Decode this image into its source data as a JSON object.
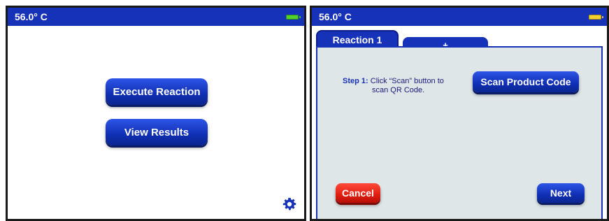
{
  "left_screen": {
    "status": {
      "temperature": "56.0° C",
      "battery_color": "#53d12b"
    },
    "execute_button": "Execute Reaction",
    "results_button": "View Results",
    "settings_icon": "gear-icon"
  },
  "right_screen": {
    "status": {
      "temperature": "56.0° C",
      "battery_color": "#f2d232"
    },
    "tabs": [
      {
        "label": "Reaction 1"
      },
      {
        "label": "+"
      }
    ],
    "step": {
      "label": "Step 1:",
      "text_line1": "Click “Scan” button to",
      "text_line2": "scan QR Code."
    },
    "scan_button": "Scan Product Code",
    "cancel_button": "Cancel",
    "next_button": "Next"
  },
  "colors": {
    "status_bar": "#1632b8",
    "button_blue": "#1632b8",
    "button_red": "#e01d10",
    "panel_bg": "#dfe6e8"
  }
}
